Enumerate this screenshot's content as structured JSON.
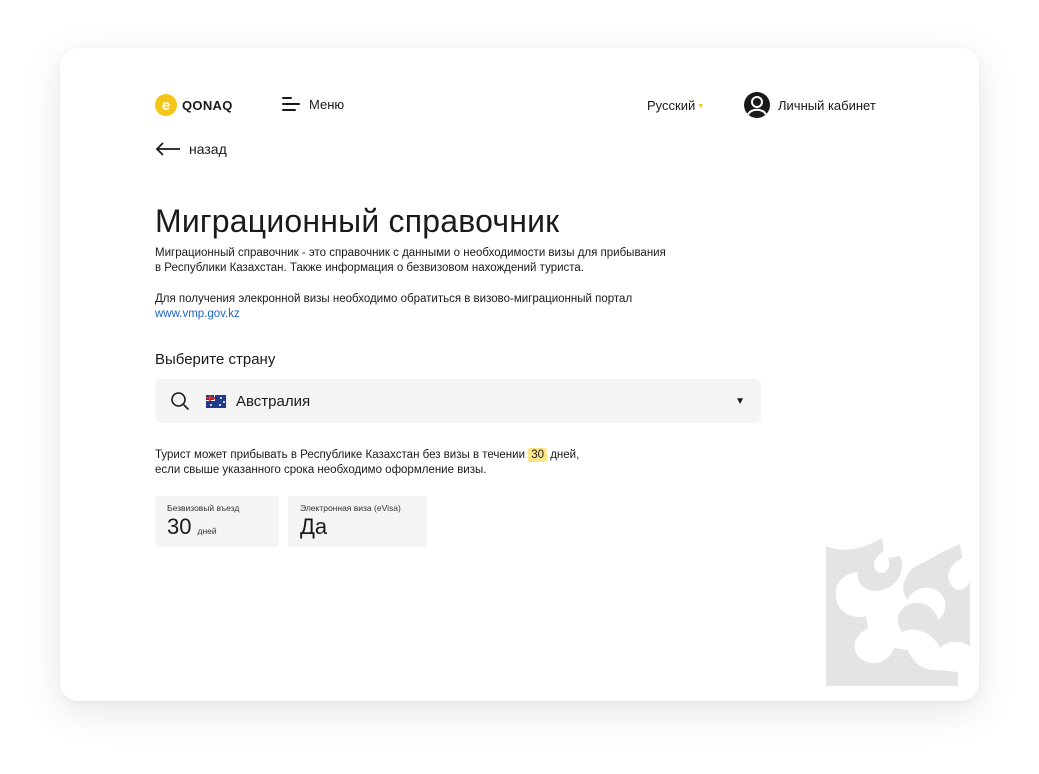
{
  "header": {
    "logo_letter": "e",
    "logo_text": "QONAQ",
    "menu_label": "Меню",
    "language": "Русский",
    "cabinet_label": "Личный кабинет"
  },
  "nav": {
    "back_label": "назад"
  },
  "main": {
    "title": "Миграционный справочник",
    "description_line1": "Миграционный справочник - это справочник с данными о необходимости визы для прибывания",
    "description_line2": "в Республики Казахстан.  Также информация о безвизовом нахождений туриста.",
    "evisa_text": "Для получения элекронной визы необходимо обратиться в визово-миграционный портал",
    "evisa_link": "www.vmp.gov.kz",
    "select_label": "Выберите страну",
    "selected_country": "Австралия",
    "info_prefix": "Турист может прибывать  в Республике Казахстан без визы  в течении",
    "info_days_value": "30",
    "info_suffix": "дней,",
    "info_line2": "если свыше указанного срока необходимо оформление визы."
  },
  "stats": {
    "visa_free": {
      "label": "Безвизовый въезд",
      "value": "30",
      "unit": "дней"
    },
    "evisa": {
      "label": "Электронная виза (eVisa)",
      "value": "Да"
    }
  },
  "colors": {
    "accent": "#f5c518",
    "link": "#1f63c7",
    "highlight": "#fbe68a",
    "field_bg": "#f4f4f4"
  }
}
